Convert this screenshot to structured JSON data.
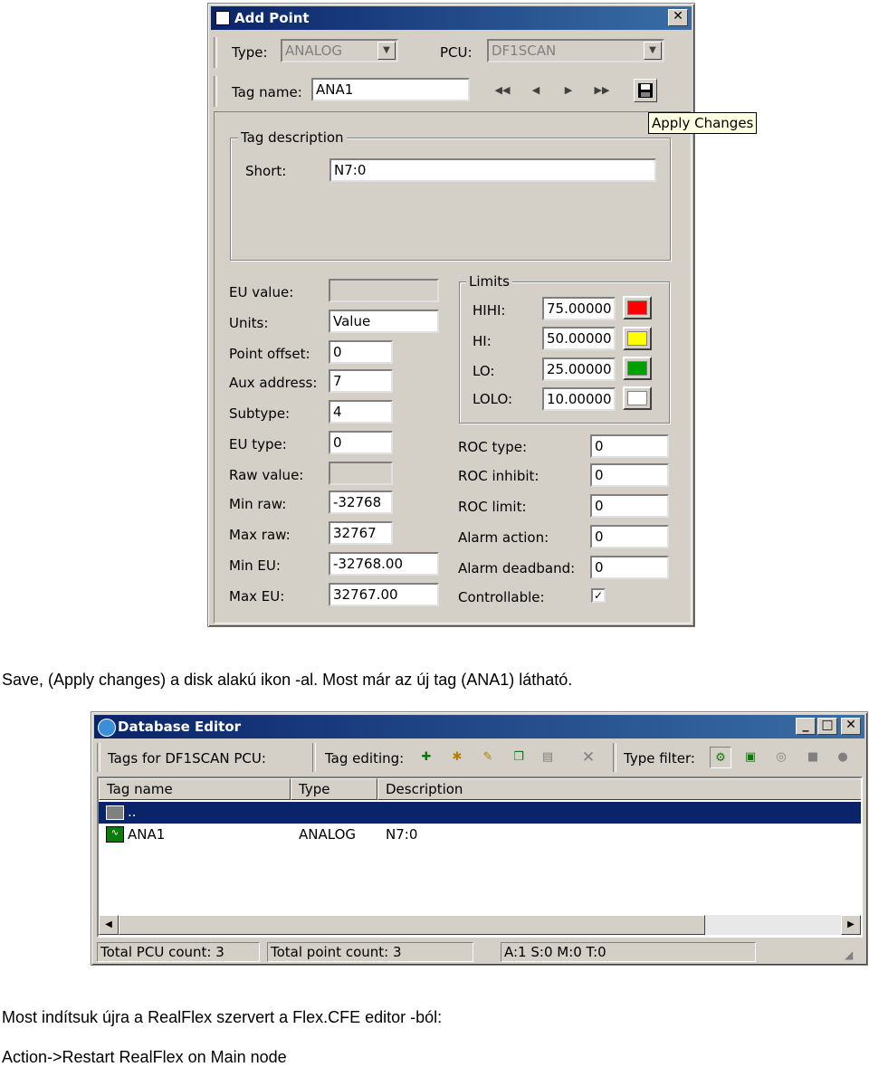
{
  "add_point": {
    "title": "Add Point",
    "type_label": "Type:",
    "type_value": "ANALOG",
    "pcu_label": "PCU:",
    "pcu_value": "DF1SCAN",
    "tagname_label": "Tag name:",
    "tagname_value": "ANA1",
    "tooltip": "Apply Changes",
    "desc_group": "Tag description",
    "short_label": "Short:",
    "short_value": "N7:0",
    "left_fields": [
      {
        "label": "EU value:",
        "value": ""
      },
      {
        "label": "Units:",
        "value": "Value"
      },
      {
        "label": "Point offset:",
        "value": "0"
      },
      {
        "label": "Aux address:",
        "value": "7"
      },
      {
        "label": "Subtype:",
        "value": "4"
      },
      {
        "label": "EU type:",
        "value": "0"
      },
      {
        "label": "Raw value:",
        "value": ""
      },
      {
        "label": "Min raw:",
        "value": "-32768"
      },
      {
        "label": "Max raw:",
        "value": "32767"
      },
      {
        "label": "Min EU:",
        "value": "-32768.00"
      },
      {
        "label": "Max EU:",
        "value": "32767.00"
      }
    ],
    "limits_group": "Limits",
    "limits": [
      {
        "label": "HIHI:",
        "value": "75.00000",
        "color": "#ff0000"
      },
      {
        "label": "HI:",
        "value": "50.00000",
        "color": "#ffff00"
      },
      {
        "label": "LO:",
        "value": "25.00000",
        "color": "#00a000"
      },
      {
        "label": "LOLO:",
        "value": "10.00000",
        "color": "#ffffff"
      }
    ],
    "right_fields": [
      {
        "label": "ROC type:",
        "value": "0"
      },
      {
        "label": "ROC inhibit:",
        "value": "0"
      },
      {
        "label": "ROC limit:",
        "value": "0"
      },
      {
        "label": "Alarm action:",
        "value": "0"
      },
      {
        "label": "Alarm deadband:",
        "value": "0"
      }
    ],
    "controllable_label": "Controllable:",
    "controllable_checked": true
  },
  "caption1": "Save, (Apply changes) a disk alakú ikon -al. Most már az új tag (ANA1) látható.",
  "db_editor": {
    "title": "Database Editor",
    "tags_for_label": "Tags for DF1SCAN PCU:",
    "tag_editing_label": "Tag editing:",
    "type_filter_label": "Type filter:",
    "columns": [
      "Tag name",
      "Type",
      "Description"
    ],
    "rows": [
      {
        "name": "..",
        "type": "",
        "desc": "",
        "selected": true
      },
      {
        "name": "ANA1",
        "type": "ANALOG",
        "desc": "N7:0",
        "selected": false
      }
    ],
    "status": [
      "Total PCU count: 3",
      "Total point count: 3",
      "A:1  S:0  M:0  T:0"
    ]
  },
  "caption2": "Most indítsuk újra a RealFlex szervert a Flex.CFE editor -ból:",
  "caption3": "Action->Restart RealFlex on Main node"
}
